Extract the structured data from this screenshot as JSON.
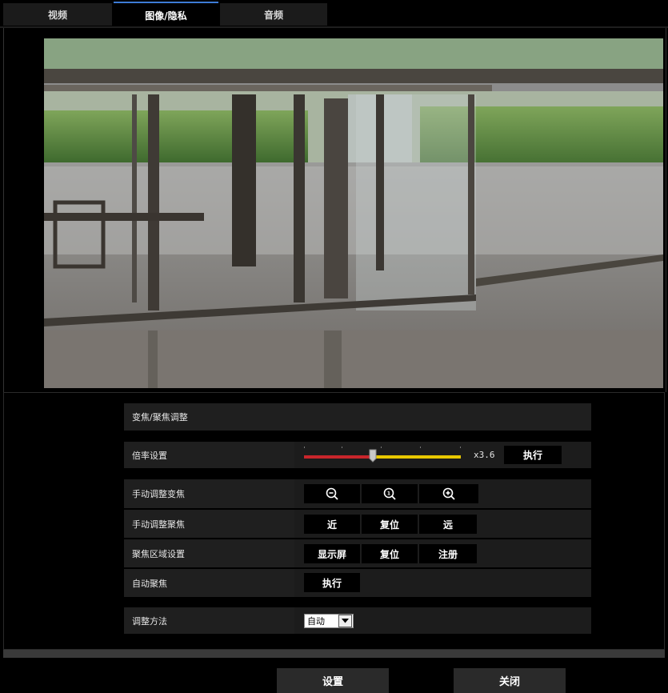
{
  "tabs": [
    {
      "label": "视频"
    },
    {
      "label": "图像/隐私"
    },
    {
      "label": "音频"
    }
  ],
  "section": {
    "title": "变焦/聚焦调整"
  },
  "zoom": {
    "label": "倍率设置",
    "value_text": "x3.6",
    "execute_label": "执行",
    "level": 0.44
  },
  "manual_zoom": {
    "label": "手动调整变焦",
    "buttons": [
      "zoom-out-icon",
      "zoom-reset-icon",
      "zoom-in-icon"
    ]
  },
  "manual_focus": {
    "label": "手动调整聚焦",
    "near_label": "近",
    "reset_label": "复位",
    "far_label": "远"
  },
  "focus_area": {
    "label": "聚焦区域设置",
    "display_label": "显示屏",
    "reset_label": "复位",
    "register_label": "注册"
  },
  "auto_focus": {
    "label": "自动聚焦",
    "execute_label": "执行"
  },
  "adjust_method": {
    "label": "调整方法",
    "selected": "自动"
  },
  "footer": {
    "set_label": "设置",
    "close_label": "关闭"
  },
  "colors": {
    "slider_left": "#c8252b",
    "slider_right": "#e8c800",
    "active_tab_accent": "#3d7bd6"
  }
}
